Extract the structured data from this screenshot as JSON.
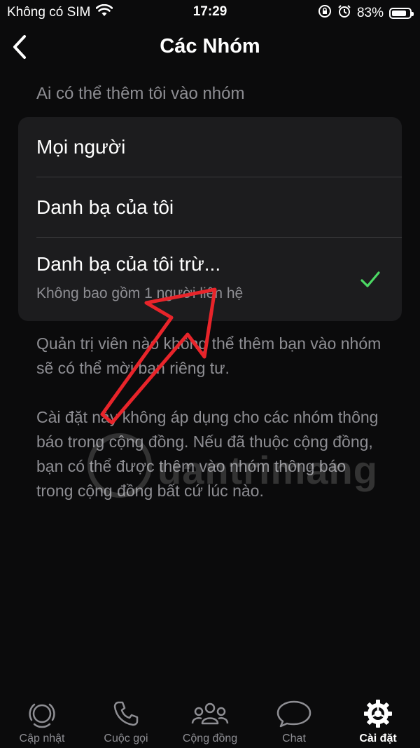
{
  "status": {
    "carrier": "Không có SIM",
    "time": "17:29",
    "battery": "83%",
    "battery_level": 0.83
  },
  "nav": {
    "title": "Các Nhóm"
  },
  "section": {
    "header": "Ai có thể thêm tôi vào nhóm"
  },
  "options": [
    {
      "label": "Mọi người"
    },
    {
      "label": "Danh bạ của tôi"
    },
    {
      "label": "Danh bạ của tôi trừ...",
      "sublabel": "Không bao gồm 1 người liên hệ",
      "selected": true
    }
  ],
  "footnotes": [
    "Quản trị viên nào không thể thêm bạn vào nhóm sẽ có thể mời bạn riêng tư.",
    "Cài đặt này không áp dụng cho các nhóm thông báo trong cộng đồng. Nếu đã thuộc cộng đồng, bạn có thể được thêm vào nhóm thông báo trong cộng đồng bất cứ lúc nào."
  ],
  "watermark": "uantrimang",
  "tabs": [
    {
      "label": "Cập nhật",
      "icon": "updates-icon"
    },
    {
      "label": "Cuộc gọi",
      "icon": "phone-icon"
    },
    {
      "label": "Cộng đồng",
      "icon": "community-icon"
    },
    {
      "label": "Chat",
      "icon": "chat-icon"
    },
    {
      "label": "Cài đặt",
      "icon": "settings-icon",
      "active": true
    }
  ],
  "colors": {
    "background": "#0b0b0c",
    "card": "#1c1c1e",
    "check": "#4cd964",
    "annotation_arrow": "#e8242a",
    "secondary_text": "#8e8e93"
  }
}
